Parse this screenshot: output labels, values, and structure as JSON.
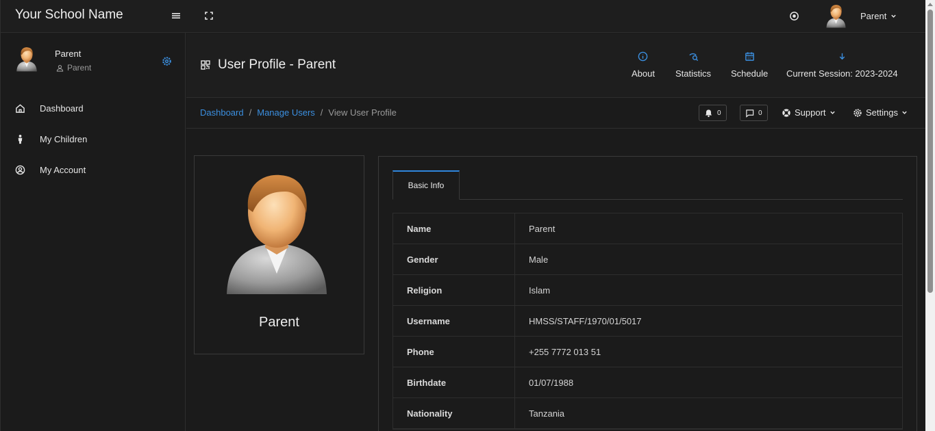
{
  "topbar": {
    "brand": "Your School Name",
    "user_label": "Parent"
  },
  "sidebar": {
    "user_name": "Parent",
    "user_role": "Parent",
    "items": [
      {
        "label": "Dashboard",
        "icon": "home-icon"
      },
      {
        "label": "My Children",
        "icon": "child-icon"
      },
      {
        "label": "My Account",
        "icon": "user-circle-icon"
      }
    ]
  },
  "header": {
    "title": "User Profile - Parent",
    "links": [
      {
        "label": "About",
        "icon": "info-icon"
      },
      {
        "label": "Statistics",
        "icon": "statistics-icon"
      },
      {
        "label": "Schedule",
        "icon": "calendar-icon"
      },
      {
        "label": "Current Session: 2023-2024",
        "icon": "arrow-down-icon"
      }
    ]
  },
  "breadcrumb": {
    "items": [
      "Dashboard",
      "Manage Users"
    ],
    "current": "View User Profile"
  },
  "toolbar": {
    "notifications_count": "0",
    "messages_count": "0",
    "support_label": "Support",
    "settings_label": "Settings"
  },
  "profile": {
    "name": "Parent"
  },
  "info": {
    "tab_label": "Basic Info",
    "rows": [
      {
        "key": "Name",
        "value": "Parent"
      },
      {
        "key": "Gender",
        "value": "Male"
      },
      {
        "key": "Religion",
        "value": "Islam"
      },
      {
        "key": "Username",
        "value": "HMSS/STAFF/1970/01/5017"
      },
      {
        "key": "Phone",
        "value": "+255 7772 013 51"
      },
      {
        "key": "Birthdate",
        "value": "01/07/1988"
      },
      {
        "key": "Nationality",
        "value": "Tanzania"
      }
    ]
  },
  "colors": {
    "accent": "#2f86dd",
    "link": "#3b8fe0",
    "background": "#1b1b1b"
  }
}
